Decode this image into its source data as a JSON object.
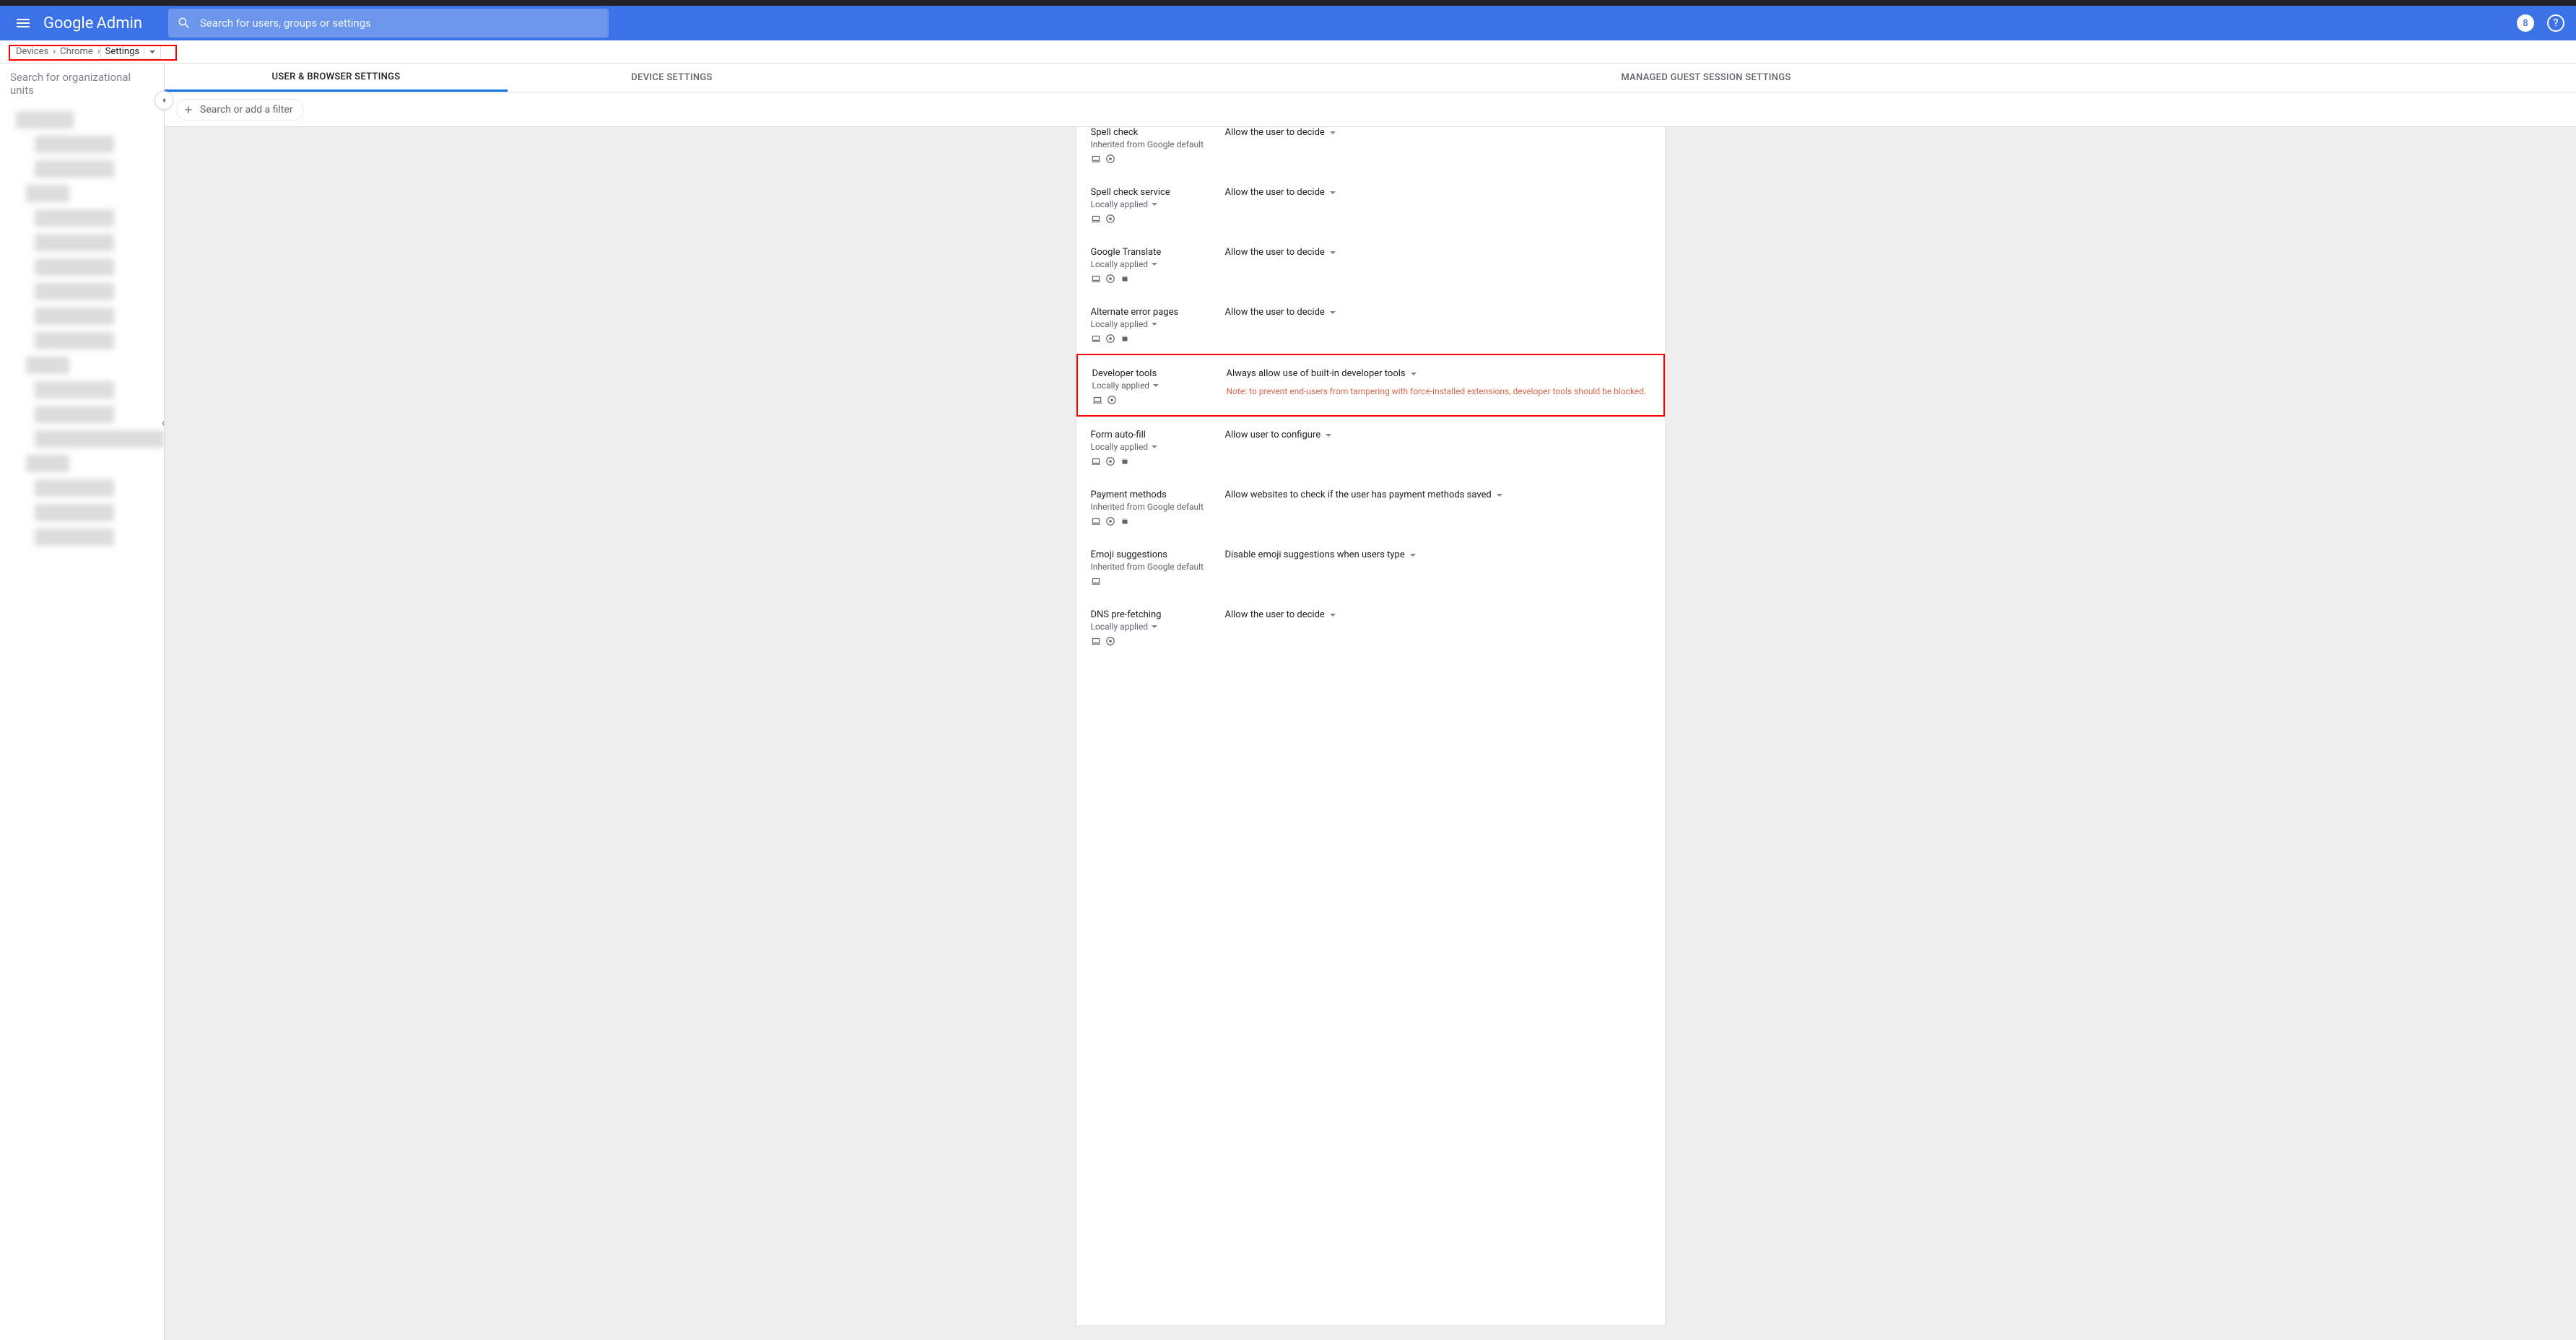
{
  "header": {
    "logo_part1": "Google",
    "logo_part2": "Admin",
    "search_placeholder": "Search for users, groups or settings",
    "badge": "8",
    "help": "?"
  },
  "breadcrumb": {
    "items": [
      "Devices",
      "Chrome",
      "Settings"
    ]
  },
  "sidebar": {
    "search_placeholder": "Search for organizational units"
  },
  "tabs": [
    {
      "label": "User & Browser Settings",
      "active": true
    },
    {
      "label": "Device Settings",
      "active": false
    },
    {
      "label": "Managed Guest Session Settings",
      "active": false
    }
  ],
  "filter": {
    "label": "Search or add a filter"
  },
  "inherit_labels": {
    "google_default": "Inherited from Google default",
    "locally_applied": "Locally applied"
  },
  "settings": [
    {
      "title": "Spell check",
      "inherit": "google_default",
      "inherit_dd": false,
      "icons": [
        "laptop",
        "chrome"
      ],
      "value": "Allow the user to decide",
      "highlight": false,
      "cut_top": true
    },
    {
      "title": "Spell check service",
      "inherit": "locally_applied",
      "inherit_dd": true,
      "icons": [
        "laptop",
        "chrome"
      ],
      "value": "Allow the user to decide",
      "highlight": false
    },
    {
      "title": "Google Translate",
      "inherit": "locally_applied",
      "inherit_dd": true,
      "icons": [
        "laptop",
        "chrome",
        "android"
      ],
      "value": "Allow the user to decide",
      "highlight": false
    },
    {
      "title": "Alternate error pages",
      "inherit": "locally_applied",
      "inherit_dd": true,
      "icons": [
        "laptop",
        "chrome",
        "android"
      ],
      "value": "Allow the user to decide",
      "highlight": false
    },
    {
      "title": "Developer tools",
      "inherit": "locally_applied",
      "inherit_dd": true,
      "icons": [
        "laptop",
        "chrome"
      ],
      "value": "Always allow use of built-in developer tools",
      "note": "Note: to prevent end-users from tampering with force-installed extensions, developer tools should be blocked.",
      "highlight": true
    },
    {
      "title": "Form auto-fill",
      "inherit": "locally_applied",
      "inherit_dd": true,
      "icons": [
        "laptop",
        "chrome",
        "android"
      ],
      "value": "Allow user to configure",
      "highlight": false
    },
    {
      "title": "Payment methods",
      "inherit": "google_default",
      "inherit_dd": false,
      "icons": [
        "laptop",
        "chrome",
        "android"
      ],
      "value": "Allow websites to check if the user has payment methods saved",
      "highlight": false
    },
    {
      "title": "Emoji suggestions",
      "inherit": "google_default",
      "inherit_dd": false,
      "icons": [
        "laptop"
      ],
      "value": "Disable emoji suggestions when users type",
      "highlight": false
    },
    {
      "title": "DNS pre-fetching",
      "inherit": "locally_applied",
      "inherit_dd": true,
      "icons": [
        "laptop",
        "chrome"
      ],
      "value": "Allow the user to decide",
      "highlight": false,
      "cut_bottom": true
    }
  ]
}
